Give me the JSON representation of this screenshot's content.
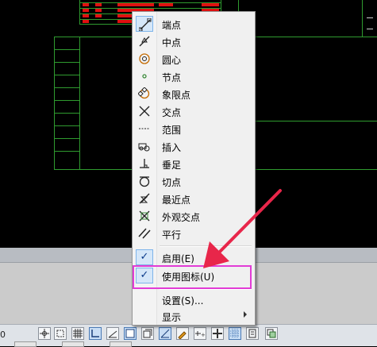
{
  "statusbar": {
    "coord_fragment": "0"
  },
  "menu": {
    "items": [
      {
        "label": "端点",
        "icon": "endpoint-snap-icon"
      },
      {
        "label": "中点",
        "icon": "midpoint-snap-icon"
      },
      {
        "label": "圆心",
        "icon": "center-snap-icon"
      },
      {
        "label": "节点",
        "icon": "node-snap-icon"
      },
      {
        "label": "象限点",
        "icon": "quadrant-snap-icon"
      },
      {
        "label": "交点",
        "icon": "intersection-snap-icon"
      },
      {
        "label": "范围",
        "icon": "extension-snap-icon"
      },
      {
        "label": "插入",
        "icon": "insert-snap-icon"
      },
      {
        "label": "垂足",
        "icon": "perpendicular-snap-icon"
      },
      {
        "label": "切点",
        "icon": "tangent-snap-icon"
      },
      {
        "label": "最近点",
        "icon": "nearest-snap-icon"
      },
      {
        "label": "外观交点",
        "icon": "apparent-intersection-snap-icon"
      },
      {
        "label": "平行",
        "icon": "parallel-snap-icon"
      }
    ],
    "toggles": [
      {
        "label": "启用(E)",
        "checked": true
      },
      {
        "label": "使用图标(U)",
        "checked": true
      }
    ],
    "settings_label": "设置(S)...",
    "display_label": "显示"
  },
  "colors": {
    "highlight": "#e23cd6",
    "arrow": "#e8264a",
    "drawing_lines": "#2f9b2f"
  }
}
